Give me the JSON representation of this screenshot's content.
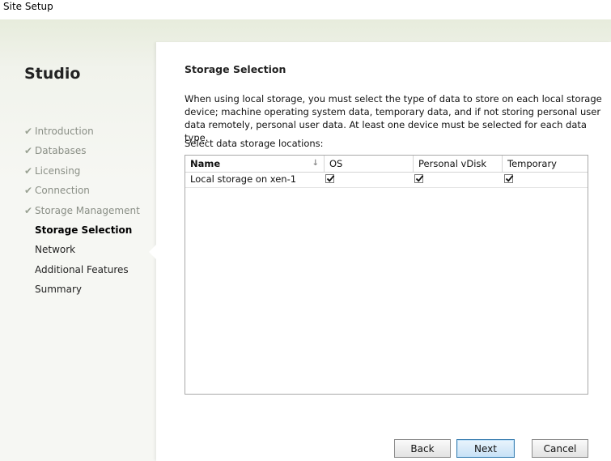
{
  "window": {
    "title": "Site Setup"
  },
  "sidebar": {
    "brand": "Studio",
    "steps": [
      {
        "label": "Introduction",
        "state": "done"
      },
      {
        "label": "Databases",
        "state": "done"
      },
      {
        "label": "Licensing",
        "state": "done"
      },
      {
        "label": "Connection",
        "state": "done"
      },
      {
        "label": "Storage Management",
        "state": "done"
      },
      {
        "label": "Storage Selection",
        "state": "active"
      },
      {
        "label": "Network",
        "state": "todo"
      },
      {
        "label": "Additional Features",
        "state": "todo"
      },
      {
        "label": "Summary",
        "state": "todo"
      }
    ],
    "check_glyph": "✔"
  },
  "main": {
    "heading": "Storage Selection",
    "description": "When using local storage, you must select the type of data to store on each local storage device; machine operating system data, temporary data, and if not storing personal user data remotely, personal user data. At least one device must be selected for each data type.",
    "subheading": "Select data storage locations:",
    "table": {
      "columns": [
        "Name",
        "OS",
        "Personal vDisk",
        "Temporary"
      ],
      "sort_glyph": "↓",
      "rows": [
        {
          "name": "Local storage on xen-1",
          "os": true,
          "personal_vdisk": true,
          "temporary": true
        }
      ]
    }
  },
  "buttons": {
    "back": "Back",
    "next": "Next",
    "cancel": "Cancel"
  }
}
